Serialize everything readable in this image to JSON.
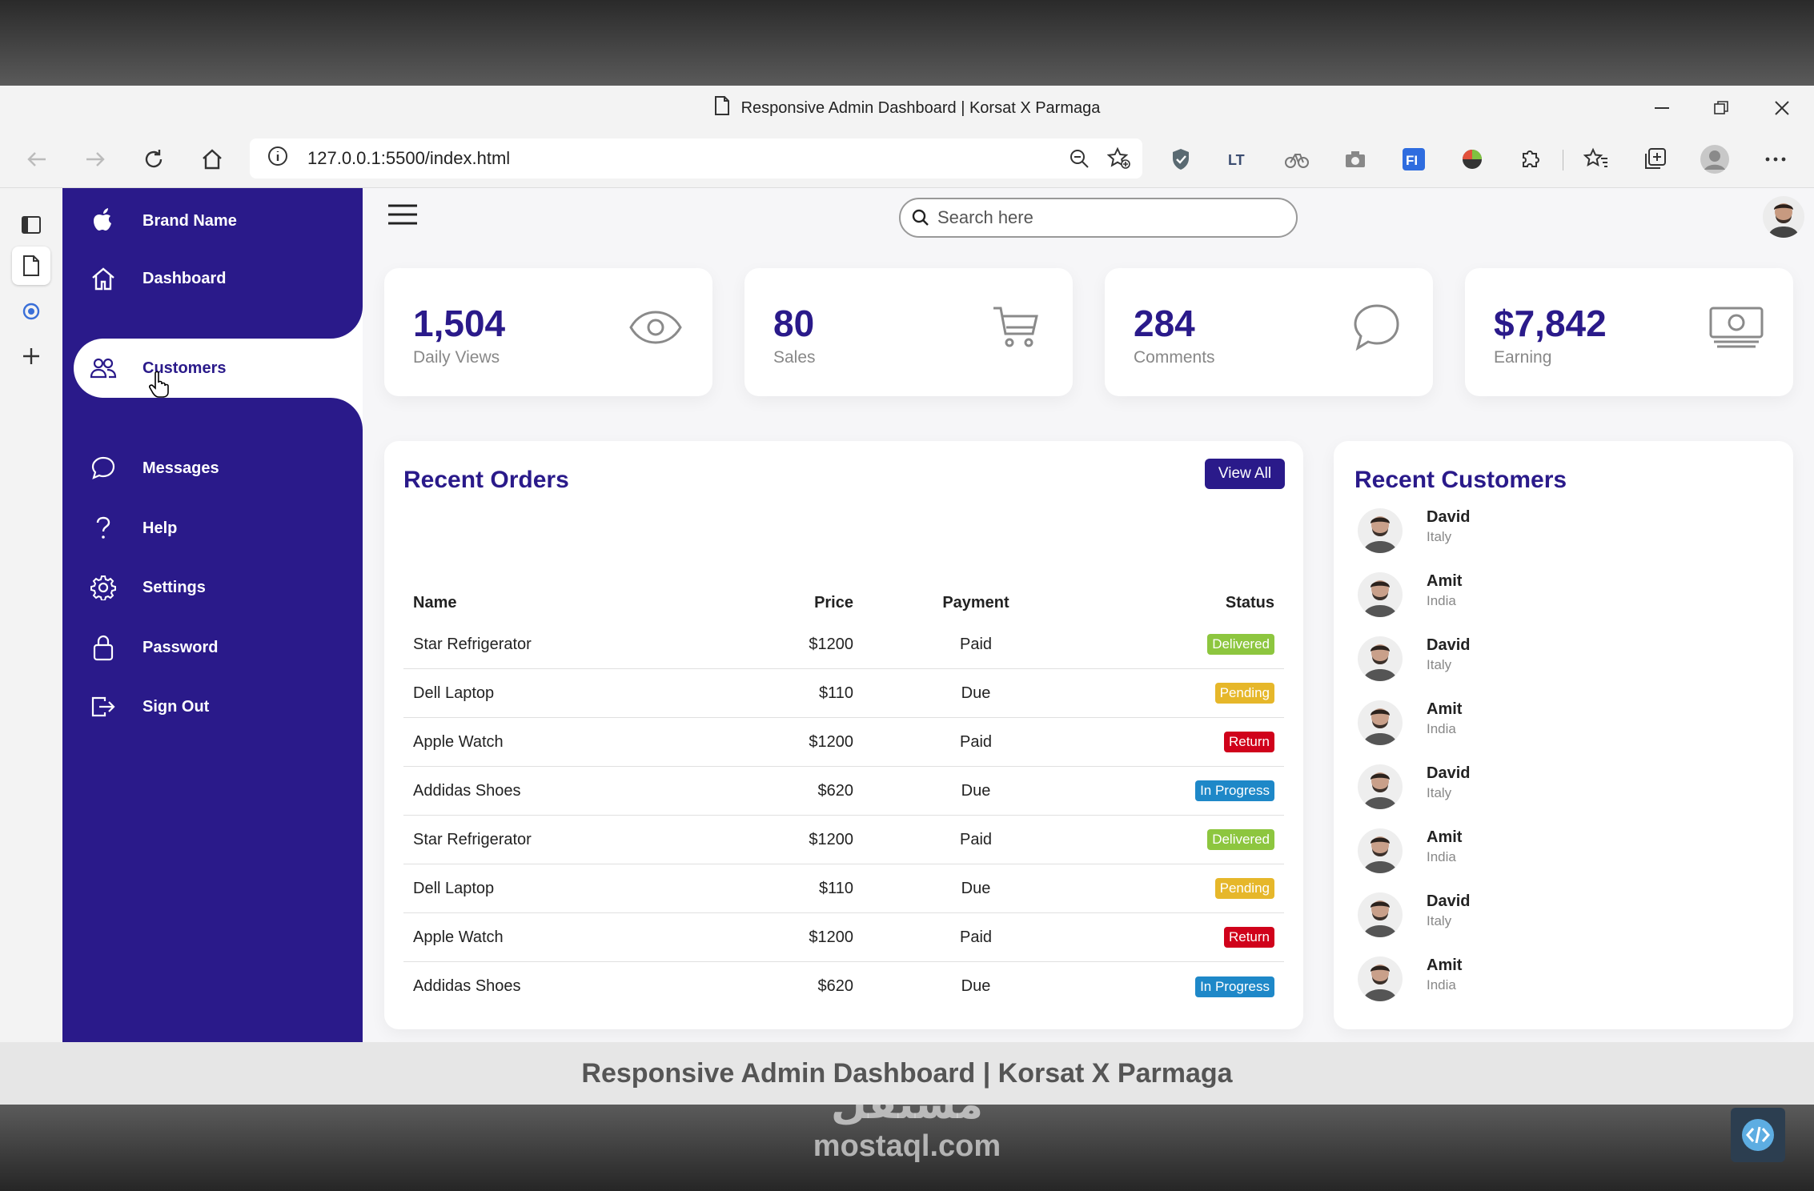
{
  "browser": {
    "tab_title": "Responsive Admin Dashboard | Korsat X Parmaga",
    "url": "127.0.0.1:5500/index.html"
  },
  "sidebar": {
    "brand": "Brand Name",
    "items": [
      {
        "label": "Dashboard",
        "icon": "home-icon"
      },
      {
        "label": "Customers",
        "icon": "users-icon",
        "active": true
      },
      {
        "label": "Messages",
        "icon": "chat-icon"
      },
      {
        "label": "Help",
        "icon": "help-icon"
      },
      {
        "label": "Settings",
        "icon": "gear-icon"
      },
      {
        "label": "Password",
        "icon": "lock-icon"
      },
      {
        "label": "Sign Out",
        "icon": "sign-out-icon"
      }
    ]
  },
  "search": {
    "placeholder": "Search here"
  },
  "cards": [
    {
      "value": "1,504",
      "label": "Daily Views",
      "icon": "eye-icon"
    },
    {
      "value": "80",
      "label": "Sales",
      "icon": "cart-icon"
    },
    {
      "value": "284",
      "label": "Comments",
      "icon": "comment-icon"
    },
    {
      "value": "$7,842",
      "label": "Earning",
      "icon": "cash-icon"
    }
  ],
  "orders": {
    "title": "Recent Orders",
    "view_all": "View All",
    "columns": {
      "name": "Name",
      "price": "Price",
      "payment": "Payment",
      "status": "Status"
    },
    "rows": [
      {
        "name": "Star Refrigerator",
        "price": "$1200",
        "payment": "Paid",
        "status": "Delivered"
      },
      {
        "name": "Dell Laptop",
        "price": "$110",
        "payment": "Due",
        "status": "Pending"
      },
      {
        "name": "Apple Watch",
        "price": "$1200",
        "payment": "Paid",
        "status": "Return"
      },
      {
        "name": "Addidas Shoes",
        "price": "$620",
        "payment": "Due",
        "status": "In Progress"
      },
      {
        "name": "Star Refrigerator",
        "price": "$1200",
        "payment": "Paid",
        "status": "Delivered"
      },
      {
        "name": "Dell Laptop",
        "price": "$110",
        "payment": "Due",
        "status": "Pending"
      },
      {
        "name": "Apple Watch",
        "price": "$1200",
        "payment": "Paid",
        "status": "Return"
      },
      {
        "name": "Addidas Shoes",
        "price": "$620",
        "payment": "Due",
        "status": "In Progress"
      }
    ]
  },
  "status_colors": {
    "Delivered": "#8dc63f",
    "Pending": "#e6b72a",
    "Return": "#d0021b",
    "In Progress": "#1e88c8"
  },
  "customers": {
    "title": "Recent Customers",
    "list": [
      {
        "name": "David",
        "country": "Italy"
      },
      {
        "name": "Amit",
        "country": "India"
      },
      {
        "name": "David",
        "country": "Italy"
      },
      {
        "name": "Amit",
        "country": "India"
      },
      {
        "name": "David",
        "country": "Italy"
      },
      {
        "name": "Amit",
        "country": "India"
      },
      {
        "name": "David",
        "country": "Italy"
      },
      {
        "name": "Amit",
        "country": "India"
      }
    ]
  },
  "caption": "Responsive Admin Dashboard | Korsat X Parmaga",
  "watermark": {
    "arabic": "مستقل",
    "domain": "mostaql.com"
  },
  "colors": {
    "accent": "#2a1a8a"
  }
}
